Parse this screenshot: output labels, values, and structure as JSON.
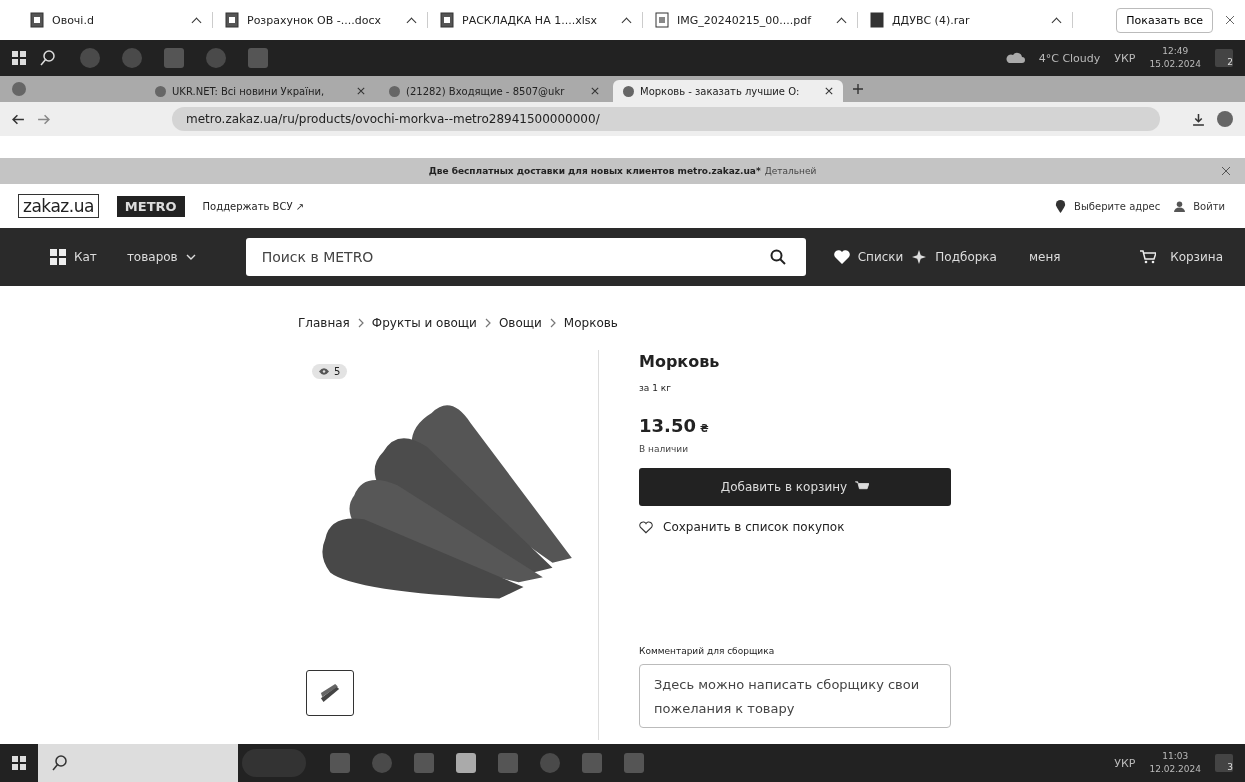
{
  "downloads": {
    "items": [
      {
        "name": "Овочі.d",
        "kind": "doc"
      },
      {
        "name": "Розрахунок ОВ -....docx",
        "kind": "doc"
      },
      {
        "name": "РАСКЛАДКА НА 1....xlsx",
        "kind": "doc"
      },
      {
        "name": "IMG_20240215_00....pdf",
        "kind": "pdf"
      },
      {
        "name": "ДДУВС (4).rar",
        "kind": "archive"
      }
    ],
    "show_all": "Показать все"
  },
  "top_taskbar": {
    "weather": "4°C Cloudy",
    "language": "УКР",
    "time": "12:49",
    "date": "15.02.2024",
    "notifications": "2"
  },
  "browser": {
    "tabs": [
      {
        "title": "UKR.NET: Всі новини України,",
        "selected": false
      },
      {
        "title": "(21282) Входящие - 8507@ukr",
        "selected": false
      },
      {
        "title": "Морковь - заказать лучшие О:",
        "selected": true
      }
    ],
    "url": "metro.zakaz.ua/ru/products/ovochi-morkva--metro28941500000000/"
  },
  "promo": {
    "text": "Две бесплатных доставки для новых клиентов metro.zakaz.ua*",
    "link": "Детальней"
  },
  "header": {
    "logo": "zakaz.ua",
    "brand": "METRO",
    "support": "Поддержать ВСУ ↗",
    "address": "Выберите адрес",
    "login": "Войти"
  },
  "nav": {
    "catalog_start": "Кат",
    "catalog_end": "товаров",
    "search": {
      "placeholder": "Поиск в METRO"
    },
    "lists": "Списки",
    "picks_start": "Подборка",
    "picks_end": "меня",
    "cart": "Корзина"
  },
  "breadcrumbs": [
    "Главная",
    "Фрукты и овощи",
    "Овощи",
    "Морковь"
  ],
  "product": {
    "views": "5",
    "title": "Морковь",
    "unit": "за 1 кг",
    "price": "13.50",
    "currency": "₴",
    "availability": "В наличии",
    "add_button": "Добавить в корзину",
    "save": "Сохранить в список покупок",
    "comment_label": "Комментарий для сборщика",
    "comment": {
      "placeholder": "Здесь можно написать сборщику свои пожелания к товару"
    }
  },
  "bottom_taskbar": {
    "language": "УКР",
    "time": "11:03",
    "date": "12.02.2024",
    "notifications": "3"
  }
}
